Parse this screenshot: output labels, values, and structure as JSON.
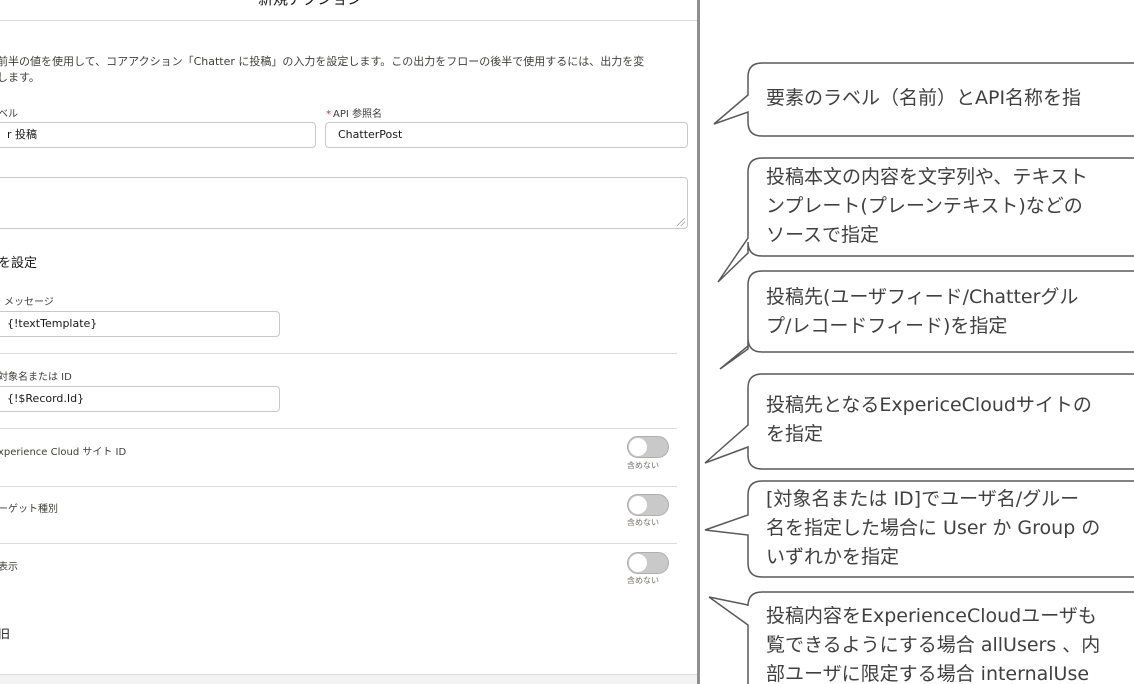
{
  "modal": {
    "title": "新規アクション",
    "description": "前半の値を使用して、コアアクション「Chatter に投稿」の入力を設定します。この出力をフローの後半で使用するには、出力を変\nします。",
    "label_field": {
      "label": "ベル",
      "value": "r 投稿"
    },
    "api_field": {
      "required_mark": "*",
      "label": "API 参照名",
      "value": "ChatterPost"
    },
    "section_title": "を設定",
    "message_field": {
      "label": "メッセージ",
      "value": "{!textTemplate}"
    },
    "target_field": {
      "label": "対象名または ID",
      "value": "{!$Record.Id}"
    },
    "toggles": [
      {
        "label": "xperience Cloud サイト ID",
        "state_label": "含めない",
        "on": false
      },
      {
        "label": "ーゲット種別",
        "state_label": "含めない",
        "on": false
      },
      {
        "label": "表示",
        "state_label": "含めない",
        "on": false
      }
    ],
    "bottom_label": "旧"
  },
  "callouts": [
    {
      "text": "要素のラベル（名前）とAPI名称を指"
    },
    {
      "text": "投稿本文の内容を文字列や、テキスト\nンプレート(プレーンテキスト)などの\nソースで指定"
    },
    {
      "text": "投稿先(ユーザフィード/Chatterグル\nプ/レコードフィード)を指定"
    },
    {
      "text": "投稿先となるExpericeCloudサイトの\nを指定"
    },
    {
      "text": "[対象名または ID]でユーザ名/グルー\n名を指定した場合に User か Group の\nいずれかを指定"
    },
    {
      "text": "投稿内容をExperienceCloudユーザも\n覧できるようにする場合 allUsers 、内\n部ユーザに限定する場合 internalUse"
    }
  ],
  "colors": {
    "callout_border": "#595959",
    "separator": "#8f8f8f",
    "required": "#c23934"
  }
}
